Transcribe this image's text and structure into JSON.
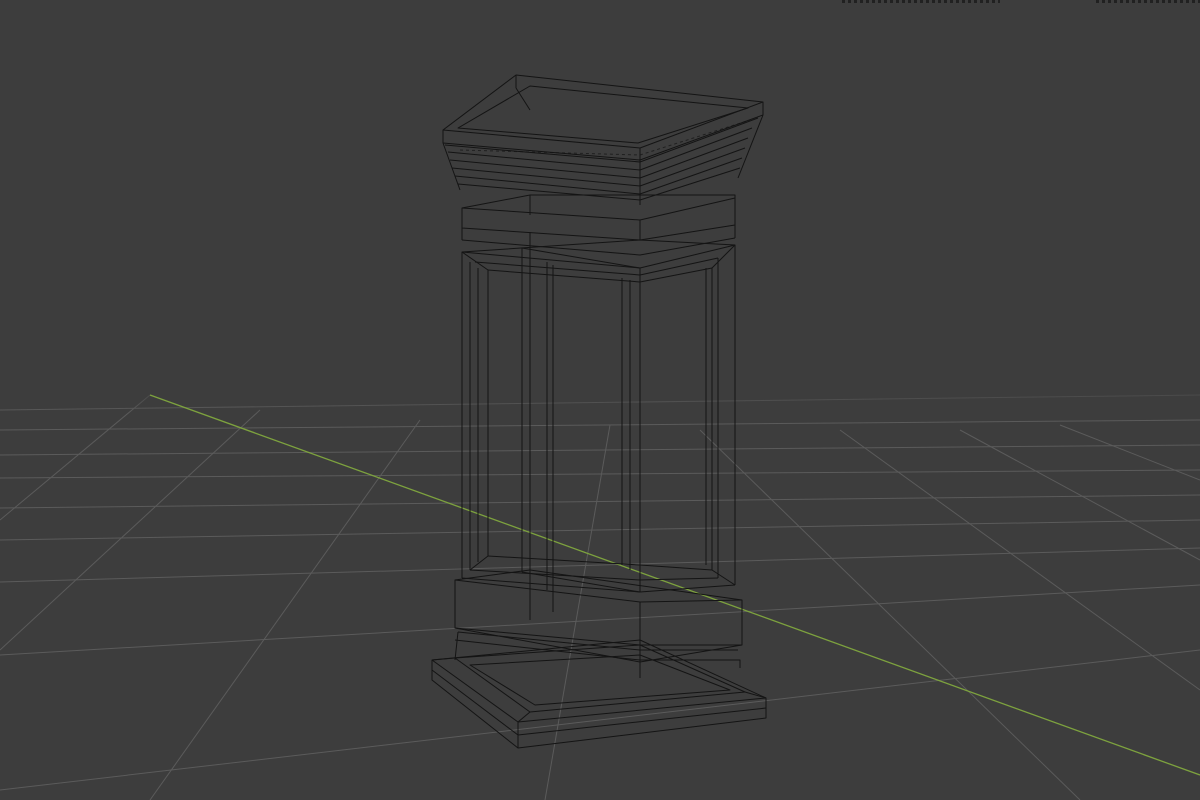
{
  "app": {
    "view": "3D Viewport",
    "shading": "wireframe"
  },
  "colors": {
    "background": "#3d3d3d",
    "grid": "#5a5a5a",
    "y_axis": "#80a640",
    "wire": "#121212"
  },
  "scene": {
    "object": "pillar-pedestal"
  }
}
